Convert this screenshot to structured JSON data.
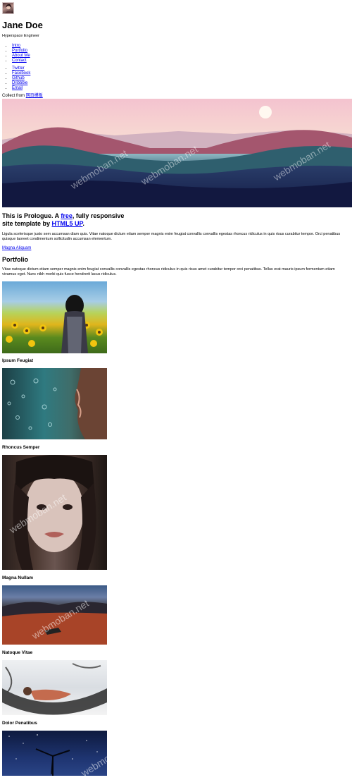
{
  "header": {
    "name": "Jane Doe",
    "tagline": "Hyperspace Engineer",
    "avatar_icon": "avatar-portrait-icon"
  },
  "nav": {
    "primary": [
      "Intro",
      "Portfolio",
      "About Me",
      "Contact"
    ],
    "social": [
      "Twitter",
      "Facebook",
      "Github",
      "Dribbble",
      "Email"
    ]
  },
  "collect": {
    "prefix": "Collect from ",
    "link": "网页模板"
  },
  "intro": {
    "title_part1": "This is Prologue. A ",
    "title_free": "free",
    "title_part2": ", fully responsive",
    "title_line2": "site template by ",
    "title_link": "HTML5 UP",
    "title_end": ".",
    "body": "Ligula scelerisque justo sem accumsan diam quis. Vitae natoque dictum etiam semper magnis enim feugiat convallis convallis egestas rhoncus ridiculus in quis risus curabitur tempor. Orci penatibus quisque laoreet condimentum sollicitudin accumsan elementum.",
    "cta": "Magna Aliquam"
  },
  "portfolio": {
    "heading": "Portfolio",
    "body": "Vitae natoque dictum etiam semper magnis enim feugiat convallis convallis egestas rhoncus ridiculus in quis risus amet curabitur tempor orci penatibus. Tellus erat mauris ipsum fermentum etiam vivamus eget. Nunc nibh morbi quis fusce hendrerit lacus ridiculus.",
    "items": [
      {
        "title": "Ipsum Feugiat"
      },
      {
        "title": "Rhoncus Semper"
      },
      {
        "title": "Magna Nullam"
      },
      {
        "title": "Natoque Vitae"
      },
      {
        "title": "Dolor Penatibus"
      }
    ]
  },
  "watermark": "webmoban.net",
  "colors": {
    "link": "#0000ee",
    "text": "#000000",
    "bg": "#ffffff"
  }
}
